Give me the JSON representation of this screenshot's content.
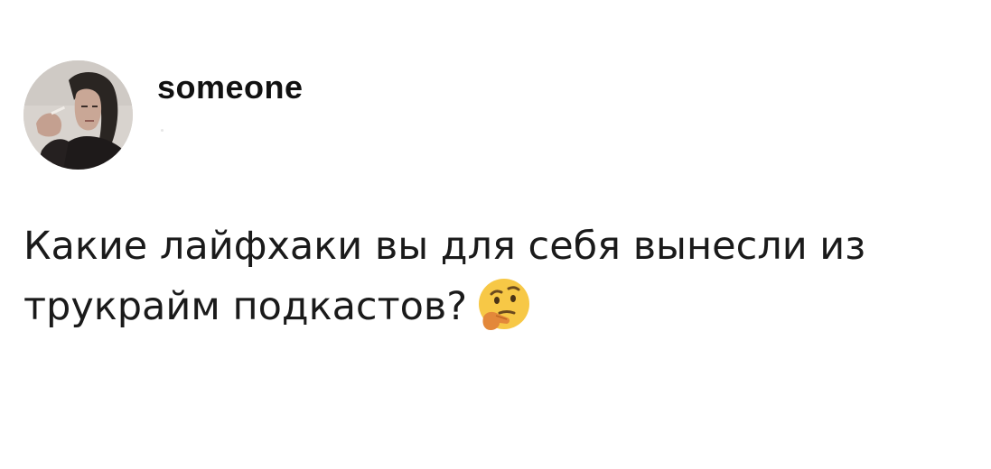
{
  "post": {
    "username": "someone",
    "text": "Какие лайфхаки вы для себя вынесли из трукрайм подкастов?",
    "emoji": "thinking-face-icon"
  },
  "colors": {
    "background": "#ffffff",
    "text": "#111111",
    "emoji_face": "#f7c846",
    "emoji_hand": "#e3883a"
  }
}
